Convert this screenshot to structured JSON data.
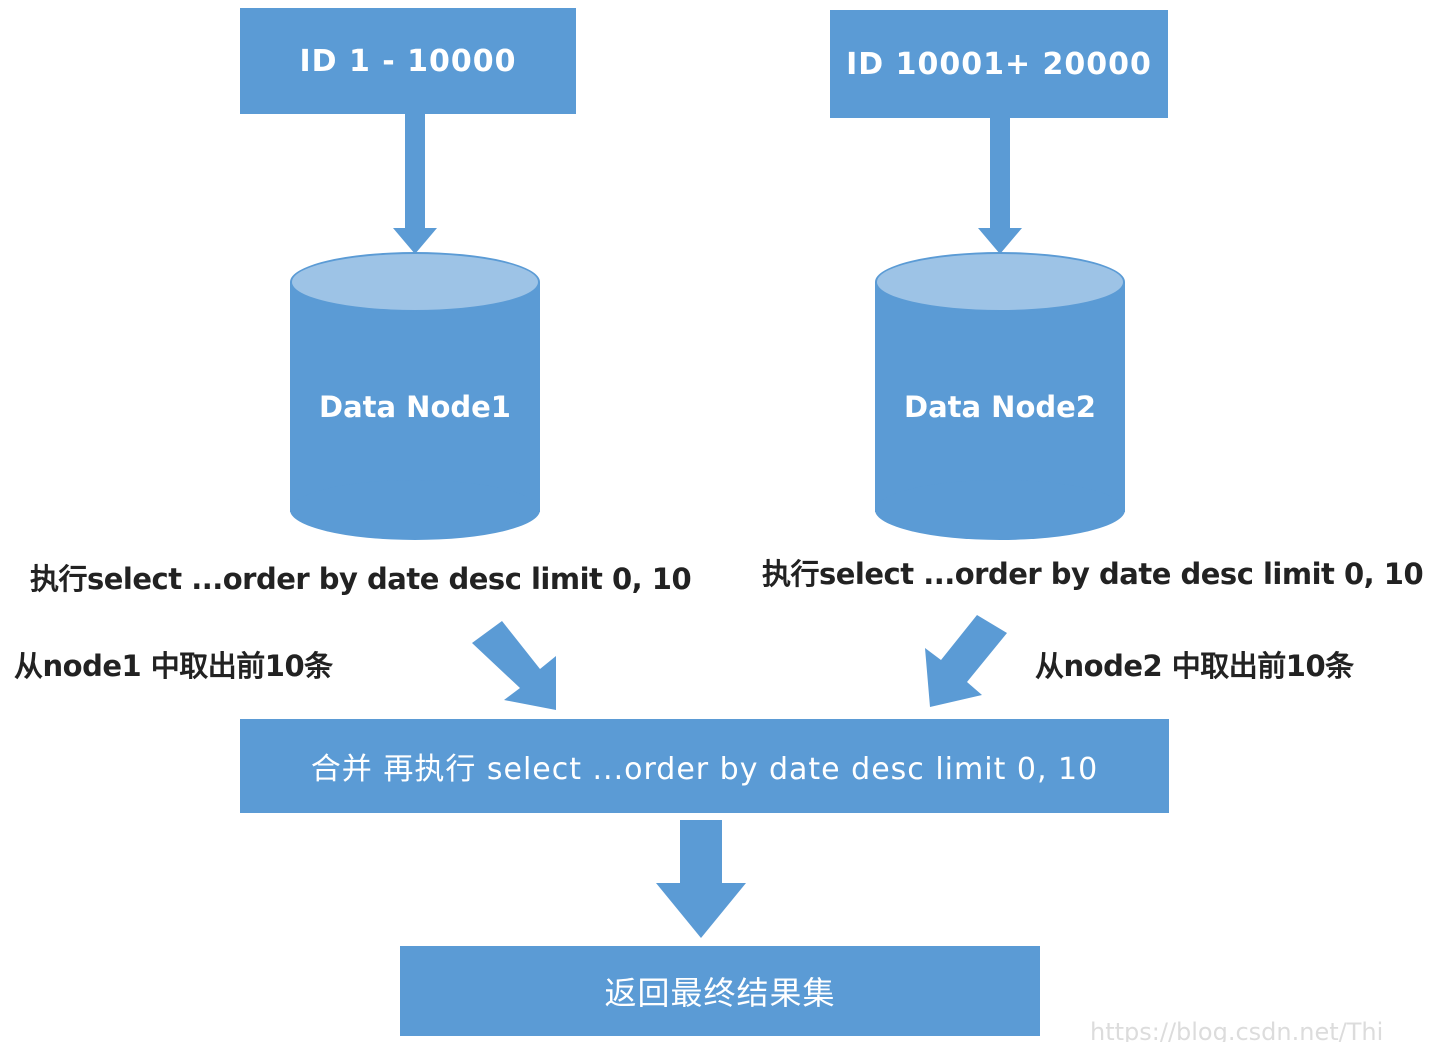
{
  "colors": {
    "box_fill": "#5b9bd5",
    "cylinder_top": "#9dc3e6",
    "text_dark": "#222222"
  },
  "left_range": {
    "label": "ID  1 - 10000"
  },
  "right_range": {
    "label": "ID  10001+ 20000"
  },
  "node1": {
    "label": "Data Node1",
    "query": "执行select ...order by date desc limit 0, 10",
    "take": "从node1 中取出前10条"
  },
  "node2": {
    "label": "Data Node2",
    "query": "执行select ...order by date desc limit 0, 10",
    "take": "从node2  中取出前10条"
  },
  "merge": {
    "label": "合并  再执行 select ...order by date desc limit 0, 10"
  },
  "result": {
    "label": "返回最终结果集"
  },
  "watermark": "https://blog.csdn.net/Thi"
}
